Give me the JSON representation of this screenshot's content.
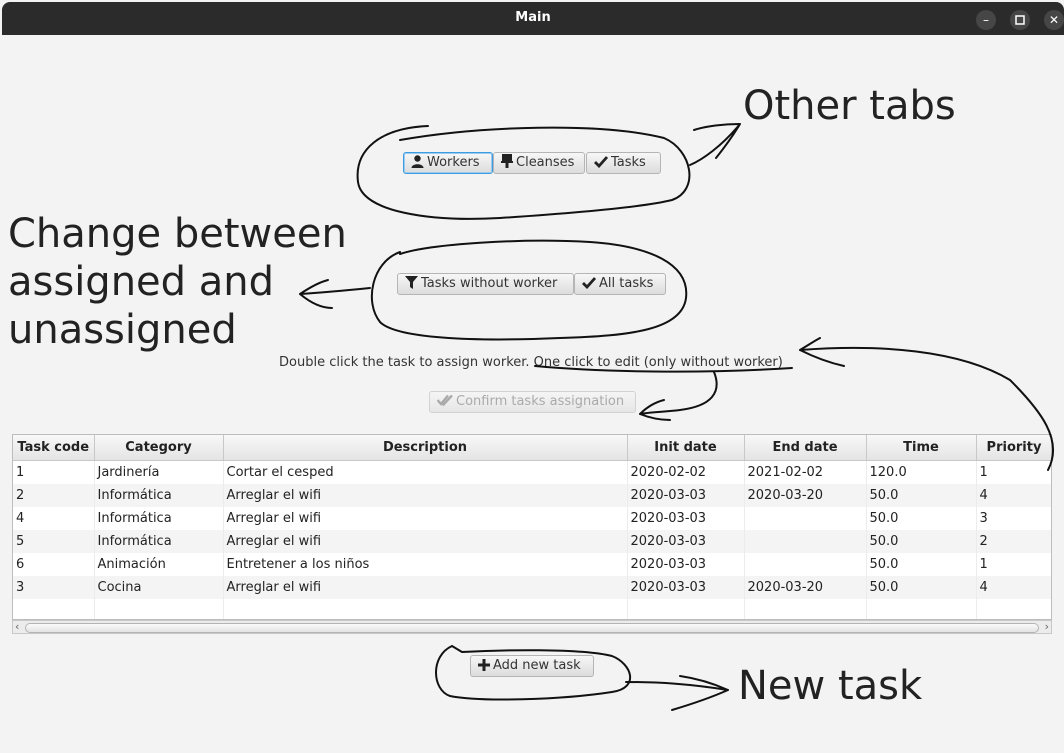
{
  "window": {
    "title": "Main",
    "controls": [
      "minimize-icon",
      "maximize-icon",
      "close-icon"
    ]
  },
  "tabs": {
    "workers": "Workers",
    "cleanses": "Cleanses",
    "tasks": "Tasks"
  },
  "filters": {
    "without_worker": "Tasks without worker",
    "all": "All tasks"
  },
  "hint": "Double click the task to assign worker. One click to edit (only without worker)",
  "confirm_label": "Confirm tasks assignation",
  "table": {
    "columns": [
      "Task code",
      "Category",
      "Description",
      "Init date",
      "End date",
      "Time",
      "Priority"
    ],
    "rows": [
      [
        "1",
        "Jardinería",
        "Cortar el cesped",
        "2020-02-02",
        "2021-02-02",
        "120.0",
        "1"
      ],
      [
        "2",
        "Informática",
        "Arreglar el wifi",
        "2020-03-03",
        "2020-03-20",
        "50.0",
        "4"
      ],
      [
        "4",
        "Informática",
        "Arreglar el wifi",
        "2020-03-03",
        "",
        "50.0",
        "3"
      ],
      [
        "5",
        "Informática",
        "Arreglar el wifi",
        "2020-03-03",
        "",
        "50.0",
        "2"
      ],
      [
        "6",
        "Animación",
        "Entretener a los niños",
        "2020-03-03",
        "",
        "50.0",
        "1"
      ],
      [
        "3",
        "Cocina",
        "Arreglar el wifi",
        "2020-03-03",
        "2020-03-20",
        "50.0",
        "4"
      ]
    ]
  },
  "add_label": "Add new task",
  "annotations": {
    "other_tabs": "Other tabs",
    "change_line1": "Change between",
    "change_line2": "assigned and",
    "change_line3": "unassigned",
    "new_task": "New task"
  }
}
